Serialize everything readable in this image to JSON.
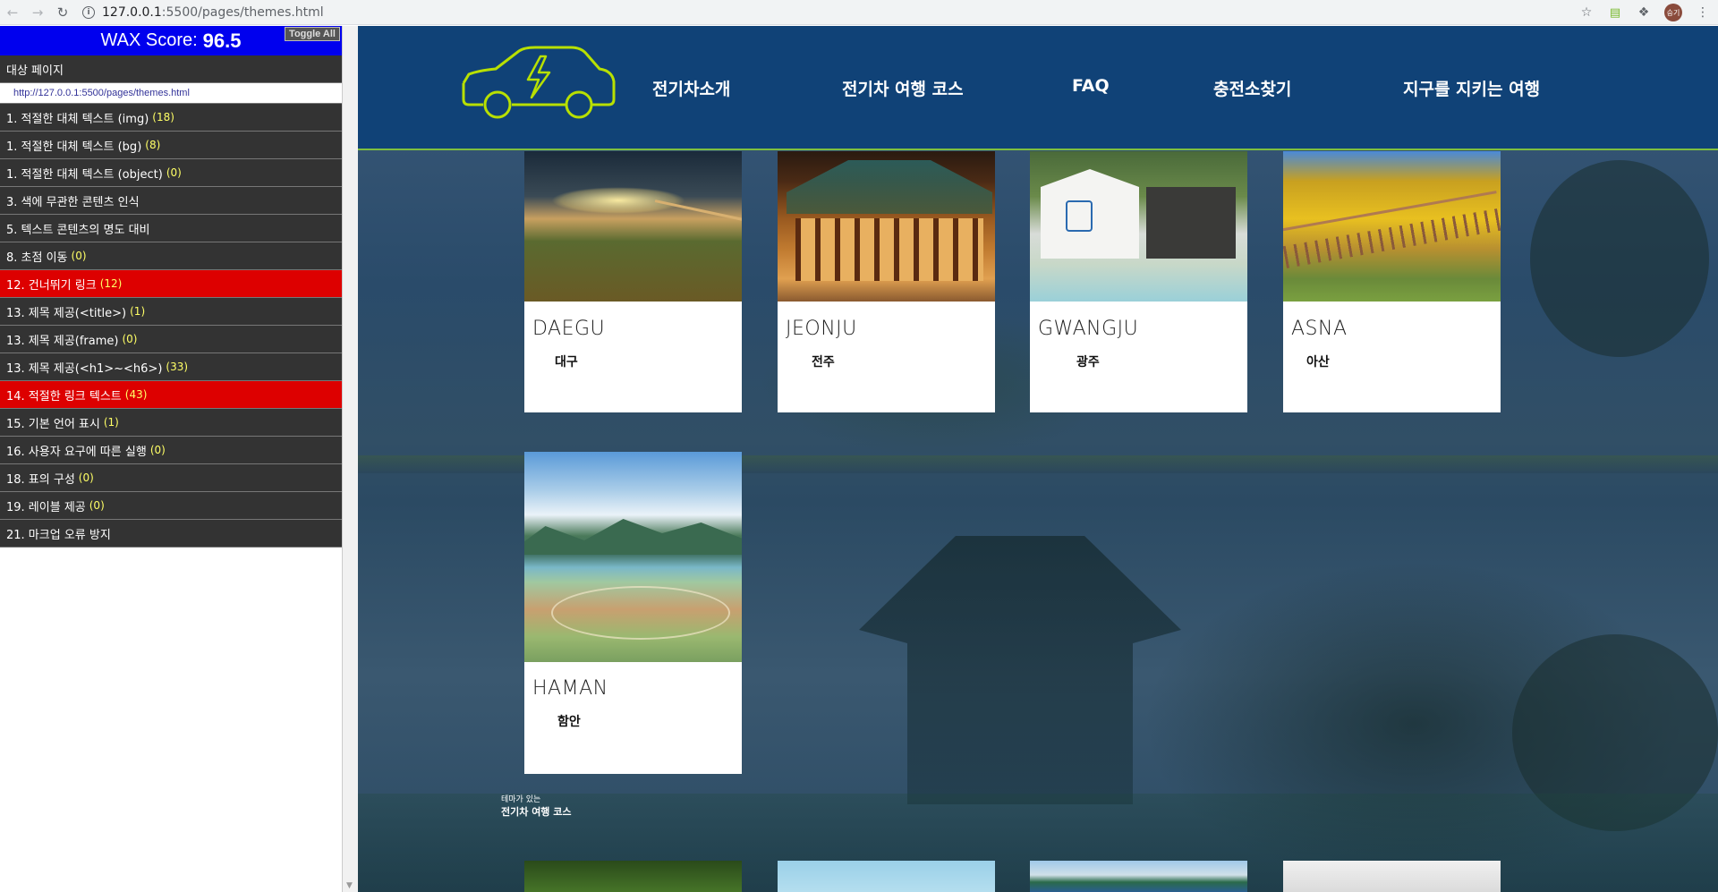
{
  "browser": {
    "url_host": "127.0.0.1",
    "url_path": ":5500/pages/themes.html",
    "avatar_label": "승기"
  },
  "wax": {
    "score_label": "WAX Score:",
    "score_value": "96.5",
    "toggle_label": "Toggle All",
    "target_label": "대상 페이지",
    "target_url": "http://127.0.0.1:5500/pages/themes.html",
    "rows": [
      {
        "label": "1. 적절한 대체 텍스트 (img)",
        "count": "(18)",
        "status": "normal"
      },
      {
        "label": "1. 적절한 대체 텍스트 (bg)",
        "count": "(8)",
        "status": "normal"
      },
      {
        "label": "1. 적절한 대체 텍스트 (object)",
        "count": "(0)",
        "status": "normal"
      },
      {
        "label": "3. 색에 무관한 콘텐츠 인식",
        "count": "",
        "status": "normal"
      },
      {
        "label": "5. 텍스트 콘텐츠의 명도 대비",
        "count": "",
        "status": "normal"
      },
      {
        "label": "8. 초점 이동",
        "count": "(0)",
        "status": "normal"
      },
      {
        "label": "12. 건너뛰기 링크",
        "count": "(12)",
        "status": "error"
      },
      {
        "label": "13. 제목 제공(<title>)",
        "count": "(1)",
        "status": "normal"
      },
      {
        "label": "13. 제목 제공(frame)",
        "count": "(0)",
        "status": "normal"
      },
      {
        "label": "13. 제목 제공(<h1>~<h6>)",
        "count": "(33)",
        "status": "normal"
      },
      {
        "label": "14. 적절한 링크 텍스트",
        "count": "(43)",
        "status": "error"
      },
      {
        "label": "15. 기본 언어 표시",
        "count": "(1)",
        "status": "normal"
      },
      {
        "label": "16. 사용자 요구에 따른 실행",
        "count": "(0)",
        "status": "normal"
      },
      {
        "label": "18. 표의 구성",
        "count": "(0)",
        "status": "normal"
      },
      {
        "label": "19. 레이블 제공",
        "count": "(0)",
        "status": "normal"
      },
      {
        "label": "21. 마크업 오류 방지",
        "count": "",
        "status": "normal"
      }
    ]
  },
  "site": {
    "nav": [
      "전기차소개",
      "전기차 여행 코스",
      "FAQ",
      "충전소찾기",
      "지구를 지키는 여행"
    ],
    "accent": "#7fbf3f",
    "nav_bg": "#104277",
    "cards": [
      {
        "en": "DAEGU",
        "ko": "대구"
      },
      {
        "en": "JEONJU",
        "ko": "전주"
      },
      {
        "en": "GWANGJU",
        "ko": "광주"
      },
      {
        "en": "ASNA",
        "ko": "아산"
      },
      {
        "en": "HAMAN",
        "ko": "함안"
      }
    ],
    "section": {
      "sub": "테마가 있는",
      "title": "전기차 여행 코스"
    }
  }
}
